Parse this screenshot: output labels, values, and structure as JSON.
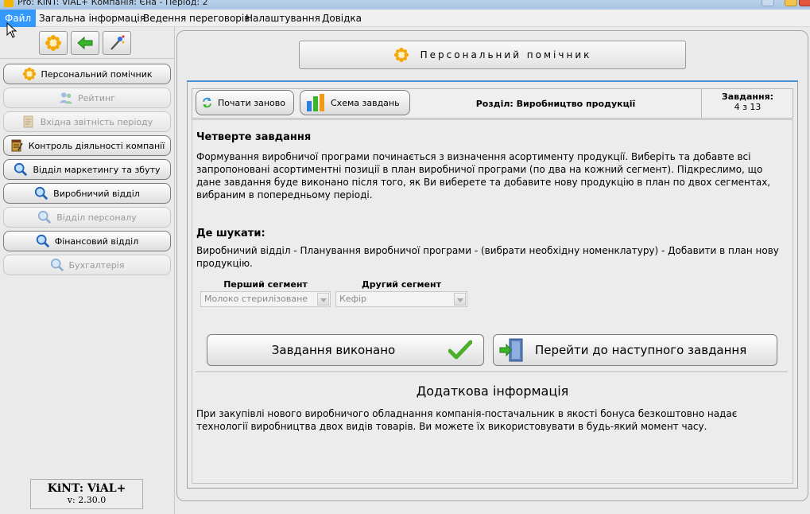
{
  "window": {
    "title": "Pro: KiNT: ViAL+   Компанія: Єна - Період: 2"
  },
  "menu": [
    {
      "label": "Файл",
      "active": true
    },
    {
      "label": "Загальна інформація"
    },
    {
      "label": "Ведення переговорів"
    },
    {
      "label": "Налаштування"
    },
    {
      "label": "Довідка"
    }
  ],
  "toolbar": {
    "icons": [
      "assistant-flower-icon",
      "back-arrow-icon",
      "magic-wand-icon"
    ]
  },
  "sidebar": {
    "items": [
      {
        "label": "Персональний помічник",
        "icon": "assistant-flower-icon",
        "enabled": true
      },
      {
        "label": "Рейтинг",
        "icon": "users-icon",
        "enabled": false
      },
      {
        "label": "Вхідна звітність періоду",
        "icon": "notepad-icon",
        "enabled": false
      },
      {
        "label": "Контроль діяльності компанії",
        "icon": "notepad-icon",
        "enabled": true
      },
      {
        "label": "Відділ маркетингу та збуту",
        "icon": "magnifier-icon",
        "enabled": true
      },
      {
        "label": "Виробничий відділ",
        "icon": "magnifier-icon",
        "enabled": true
      },
      {
        "label": "Відділ персоналу",
        "icon": "magnifier-icon",
        "enabled": false
      },
      {
        "label": "Фінансовий відділ",
        "icon": "magnifier-icon",
        "enabled": true
      },
      {
        "label": "Бухгалтерія",
        "icon": "magnifier-icon",
        "enabled": false
      }
    ],
    "version": {
      "name": "KiNT: ViAL+",
      "number": "v: 2.30.0"
    }
  },
  "main": {
    "header_button": "Персональний помічник",
    "restart_button": "Почати заново",
    "scheme_button": "Схема завдань",
    "section": "Розділ: Виробництво продукції",
    "tasks_label": "Завдання:",
    "tasks_count": "4 з 13",
    "task_title": "Четверте завдання",
    "task_text": "Формування виробничої програми починається з визначення асортименту продукції. Виберіть та добавте всі запропоновані асортиментні позиції в план виробничої програми (по два на кожний сегмент). Підкреслимо, що дане завдання буде виконано після того, як Ви виберете та добавите нову продукцію в план по двох сегментах, вибраним в попередньому періоді.",
    "where_title": "Де шукати:",
    "where_text": "Виробничий відділ - Планування виробничої програми - (вибрати необхідну номенклатуру) - Добавити в план нову продукцію.",
    "segments": [
      {
        "label": "Перший сегмент",
        "value": "Молоко стерилізоване"
      },
      {
        "label": "Другий сегмент",
        "value": "Кефір"
      }
    ],
    "done_button": "Завдання виконано",
    "next_button": "Перейти до наступного завдання",
    "extra_title": "Додаткова інформація",
    "extra_text": "При закупівлі нового виробничого обладнання компанія-постачальник в якості бонуса безкоштовно надає технології виробництва двох видів товарів. Ви можете їх використовувати в будь-який момент часу."
  },
  "colors": {
    "menu_active": "#3399ff",
    "frame_accent": "#4a90d9",
    "check_green": "#4caf2a"
  }
}
